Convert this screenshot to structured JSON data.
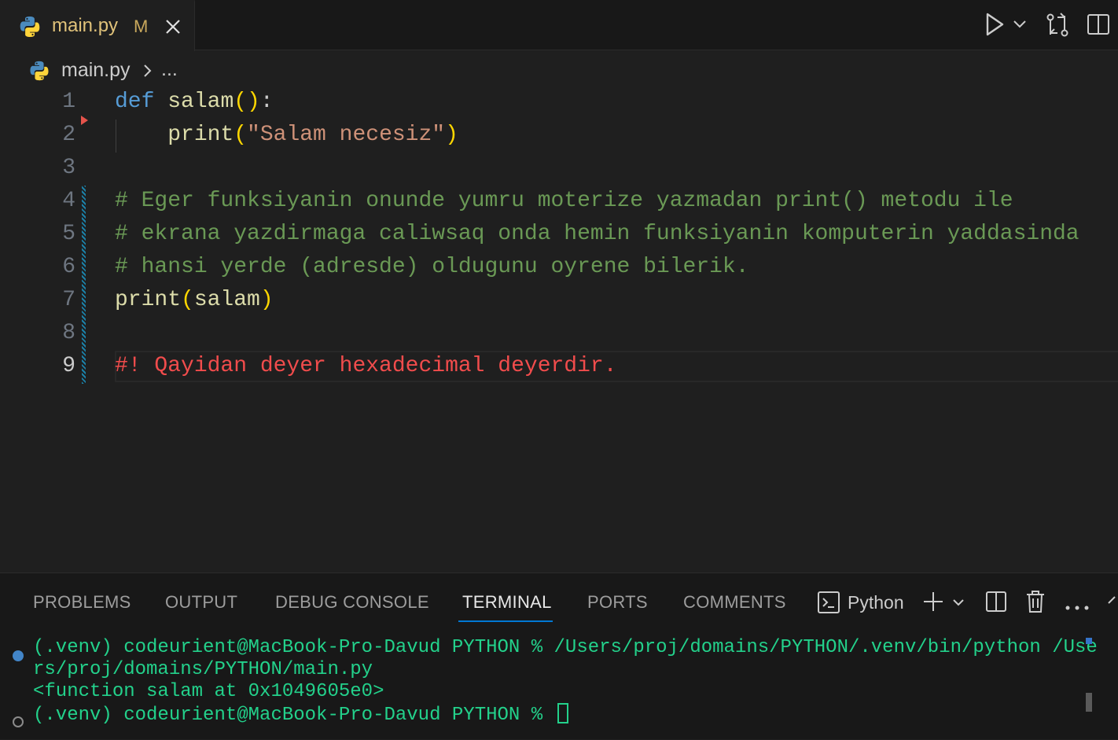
{
  "tab": {
    "filename": "main.py",
    "modified": "M"
  },
  "breadcrumb": {
    "file": "main.py",
    "more": "..."
  },
  "editor": {
    "lines": [
      {
        "n": "1"
      },
      {
        "n": "2"
      },
      {
        "n": "3"
      },
      {
        "n": "4"
      },
      {
        "n": "5"
      },
      {
        "n": "6"
      },
      {
        "n": "7"
      },
      {
        "n": "8"
      },
      {
        "n": "9"
      }
    ],
    "code": {
      "l1_kw": "def",
      "l1_fn": "salam",
      "l1_paren": "()",
      "l1_colon": ":",
      "l2_fn": "print",
      "l2_open": "(",
      "l2_str": "\"Salam necesiz\"",
      "l2_close": ")",
      "l4": "# Eger funksiyanin onunde yumru moterize yazmadan print() metodu ile",
      "l5": "# ekrana yazdirmaga caliwsaq onda hemin funksiyanin komputerin yaddasinda",
      "l6": "# hansi yerde (adresde) oldugunu oyrene bilerik.",
      "l7_fn": "print",
      "l7_open": "(",
      "l7_arg": "salam",
      "l7_close": ")",
      "l9": "#! Qayidan deyer hexadecimal deyerdir."
    }
  },
  "panel": {
    "tabs": [
      "PROBLEMS",
      "OUTPUT",
      "DEBUG CONSOLE",
      "TERMINAL",
      "PORTS",
      "COMMENTS"
    ],
    "active_tab": "TERMINAL",
    "shell_label": "Python"
  },
  "terminal": {
    "line1": "(.venv) codeurient@MacBook-Pro-Davud PYTHON % /Users/proj/domains/PYTHON/.venv/bin/python /Use",
    "line2": "rs/proj/domains/PYTHON/main.py",
    "line3": "<function salam at 0x1049605e0>",
    "line4": "(.venv) codeurient@MacBook-Pro-Davud PYTHON % "
  },
  "colors": {
    "keyword": "#569cd6",
    "function": "#dcdcaa",
    "string": "#ce9178",
    "comment": "#6a9955",
    "alert_comment": "#f14c4c",
    "terminal_text": "#23d18b",
    "accent": "#0078d4"
  },
  "icons": [
    "python-icon",
    "close-icon",
    "run-icon",
    "chevron-down-icon",
    "compare-changes-icon",
    "split-editor-icon",
    "terminal-icon",
    "plus-icon",
    "split-terminal-icon",
    "trash-icon",
    "more-icon",
    "chevron-up-icon"
  ]
}
